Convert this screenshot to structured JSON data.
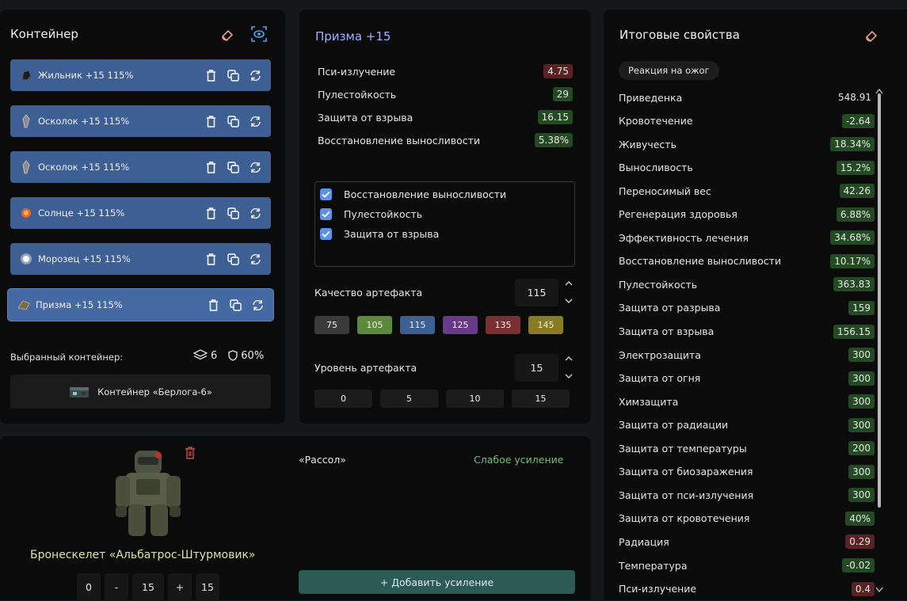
{
  "container": {
    "title": "Контейнер",
    "artifacts": [
      {
        "name": "Жильник +15  115%",
        "icon": "dark-stone-icon"
      },
      {
        "name": "Осколок +15  115%",
        "icon": "shard-icon"
      },
      {
        "name": "Осколок +15  115%",
        "icon": "shard-icon"
      },
      {
        "name": "Солнце +15  115%",
        "icon": "sun-orb-icon"
      },
      {
        "name": "Морозец +15  115%",
        "icon": "frost-orb-icon"
      },
      {
        "name": "Призма +15  115%",
        "icon": "prism-icon"
      }
    ],
    "selected_label": "Выбранный контейнер:",
    "slots": "6",
    "protection": "60%",
    "container_name": "Контейнер «Берлога-6»"
  },
  "prism": {
    "title": "Призма +15",
    "stats": [
      {
        "label": "Пси-излучение",
        "value": "4.75",
        "tone": "red"
      },
      {
        "label": "Пулестойкость",
        "value": "29",
        "tone": "green"
      },
      {
        "label": "Защита от взрыва",
        "value": "16.15",
        "tone": "green"
      },
      {
        "label": "Восстановление выносливости",
        "value": "5.38%",
        "tone": "green"
      }
    ],
    "checks": [
      "Восстановление выносливости",
      "Пулестойкость",
      "Защита от взрыва"
    ],
    "quality_label": "Качество артефакта",
    "quality_value": "115",
    "quality_presets": [
      {
        "label": "75",
        "color": "#3a3a3a"
      },
      {
        "label": "105",
        "color": "#5a8a3a"
      },
      {
        "label": "115",
        "color": "#3d5f94"
      },
      {
        "label": "125",
        "color": "#6a3a8a"
      },
      {
        "label": "135",
        "color": "#7a3030"
      },
      {
        "label": "145",
        "color": "#8a7a20"
      }
    ],
    "level_label": "Уровень артефакта",
    "level_value": "15",
    "level_presets": [
      "0",
      "5",
      "10",
      "15"
    ]
  },
  "armor": {
    "name": "Бронескелет «Альбатрос-Штурмовик»",
    "level_min": "0",
    "minus": "-",
    "level_value": "15",
    "plus": "+",
    "level_max": "15",
    "boost_name": "«Рассол»",
    "boost_level": "Слабое усиление",
    "add_boost": "+ Добавить усиление"
  },
  "totals": {
    "title": "Итоговые свойства",
    "reaction": "Реакция на ожог",
    "rows": [
      {
        "label": "Приведенка",
        "value": "548.91",
        "tone": "plain"
      },
      {
        "label": "Кровотечение",
        "value": "-2.64",
        "tone": "green"
      },
      {
        "label": "Живучесть",
        "value": "18.34%",
        "tone": "green"
      },
      {
        "label": "Выносливость",
        "value": "15.2%",
        "tone": "green"
      },
      {
        "label": "Переносимый вес",
        "value": "42.26",
        "tone": "green"
      },
      {
        "label": "Регенерация здоровья",
        "value": "6.88%",
        "tone": "green"
      },
      {
        "label": "Эффективность лечения",
        "value": "34.68%",
        "tone": "green"
      },
      {
        "label": "Восстановление выносливости",
        "value": "10.17%",
        "tone": "green"
      },
      {
        "label": "Пулестойкость",
        "value": "363.83",
        "tone": "green"
      },
      {
        "label": "Защита от разрыва",
        "value": "159",
        "tone": "green"
      },
      {
        "label": "Защита от взрыва",
        "value": "156.15",
        "tone": "green"
      },
      {
        "label": "Электрозащита",
        "value": "300",
        "tone": "green"
      },
      {
        "label": "Защита от огня",
        "value": "300",
        "tone": "green"
      },
      {
        "label": "Химзащита",
        "value": "300",
        "tone": "green"
      },
      {
        "label": "Защита от радиации",
        "value": "300",
        "tone": "green"
      },
      {
        "label": "Защита от температуры",
        "value": "200",
        "tone": "green"
      },
      {
        "label": "Защита от биозаражения",
        "value": "300",
        "tone": "green"
      },
      {
        "label": "Защита от пси-излучения",
        "value": "300",
        "tone": "green"
      },
      {
        "label": "Защита от кровотечения",
        "value": "40%",
        "tone": "green"
      },
      {
        "label": "Радиация",
        "value": "0.29",
        "tone": "red"
      },
      {
        "label": "Температура",
        "value": "-0.02",
        "tone": "green"
      },
      {
        "label": "Пси-излучение",
        "value": "0.4",
        "tone": "red"
      }
    ]
  },
  "colors": {
    "accent_blue": "#3d5f94",
    "positive": "#244a24",
    "negative": "#5a2323",
    "title_violet": "#9fb0ff",
    "boost_green": "#6fbf73",
    "add_button": "#2c5a55"
  }
}
